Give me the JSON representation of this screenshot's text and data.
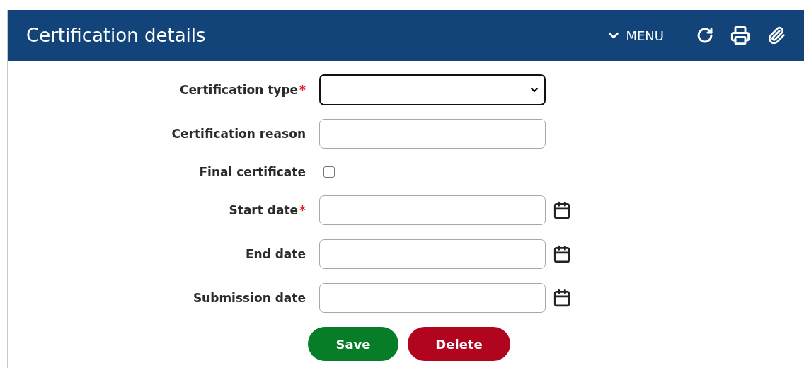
{
  "header": {
    "title": "Certification details",
    "menu_label": "MENU"
  },
  "fields": [
    {
      "kind": "select",
      "label": "Certification type",
      "required_mark": "*"
    },
    {
      "kind": "text",
      "label": "Certification reason"
    },
    {
      "kind": "checkbox",
      "label": "Final certificate",
      "checked": false
    },
    {
      "kind": "date",
      "label": "Start date",
      "required_mark": "*"
    },
    {
      "kind": "date",
      "label": "End date"
    },
    {
      "kind": "date",
      "label": "Submission date"
    }
  ],
  "buttons": [
    {
      "kind": "save",
      "label": "Save"
    },
    {
      "kind": "delete",
      "label": "Delete"
    }
  ]
}
